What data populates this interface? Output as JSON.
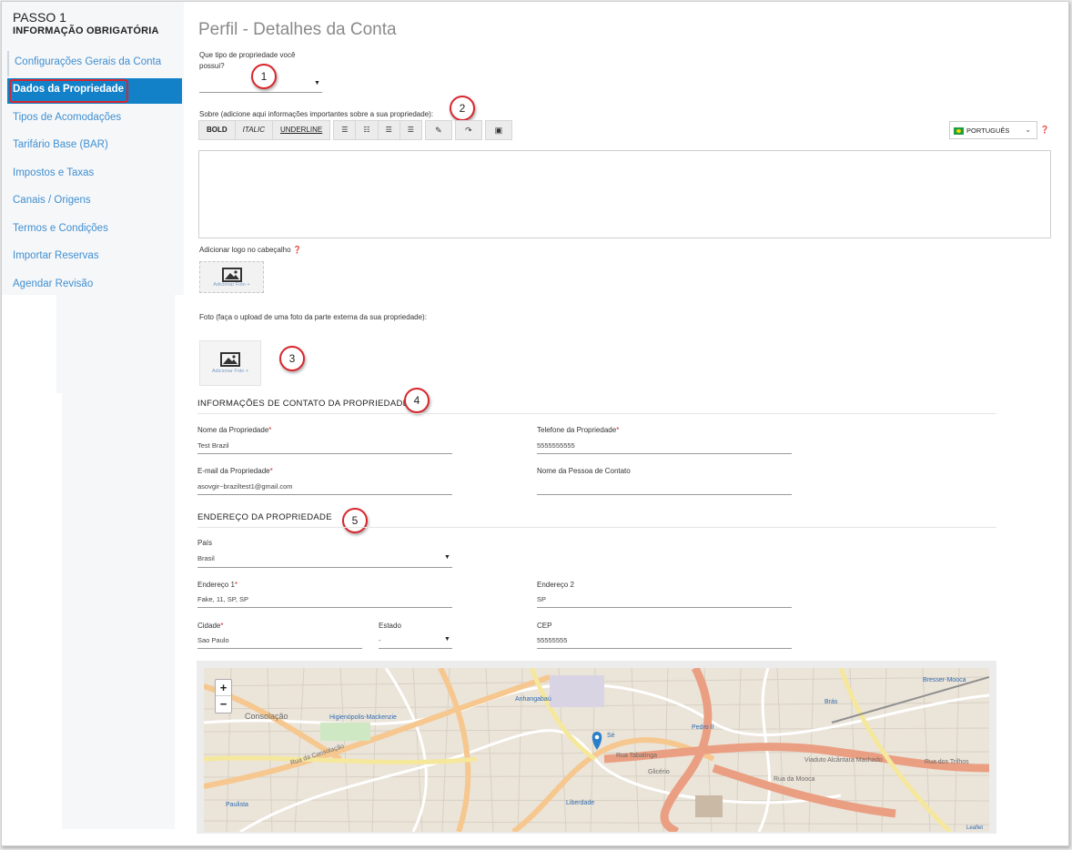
{
  "sidebar": {
    "step": "PASSO 1",
    "subtitle": "INFORMAÇÃO OBRIGATÓRIA",
    "items": [
      {
        "label": "Configurações Gerais da Conta"
      },
      {
        "label": "Dados da Propriedade"
      },
      {
        "label": "Tipos de Acomodações"
      },
      {
        "label": "Tarifário Base (BAR)"
      },
      {
        "label": "Impostos e Taxas"
      },
      {
        "label": "Canais / Origens"
      },
      {
        "label": "Termos e Condições"
      },
      {
        "label": "Importar Reservas"
      },
      {
        "label": "Agendar Revisão"
      }
    ]
  },
  "page": {
    "title": "Perfil - Detalhes da Conta"
  },
  "property_type": {
    "label_line1": "Que tipo de propriedade você",
    "label_line2": "possui?",
    "value": ""
  },
  "about": {
    "label": "Sobre (adicione aqui informações importantes sobre a sua propriedade):",
    "toolbar": {
      "bold": "BOLD",
      "italic": "ITALIC",
      "underline": "UNDERLINE"
    },
    "language": "PORTUGUÊS",
    "content": ""
  },
  "logo": {
    "label": "Adicionar logo no cabeçalho",
    "button": "Adicionar Foto +"
  },
  "photo": {
    "label": "Foto (faça o upload de uma foto da parte externa da sua propriedade):",
    "button": "Adicionar Foto +"
  },
  "contact": {
    "heading": "INFORMAÇÕES DE CONTATO DA PROPRIEDADE",
    "name_label": "Nome da Propriedade",
    "name_value": "Test Brazil",
    "phone_label": "Telefone da Propriedade",
    "phone_value": "5555555555",
    "email_label": "E-mail da Propriedade",
    "email_value": "asovgir~braziltest1@gmail.com",
    "contact_person_label": "Nome da Pessoa de Contato",
    "contact_person_value": ""
  },
  "address": {
    "heading": "ENDEREÇO DA PROPRIEDADE",
    "country_label": "País",
    "country_value": "Brasil",
    "address1_label": "Endereço 1",
    "address1_value": "Fake, 11, SP, SP",
    "address2_label": "Endereço 2",
    "address2_value": "SP",
    "city_label": "Cidade",
    "city_value": "Sao Paulo",
    "state_label": "Estado",
    "state_value": "-",
    "zip_label": "CEP",
    "zip_value": "55555555"
  },
  "map": {
    "zoom_in": "+",
    "zoom_out": "−",
    "labels": [
      "Consolação",
      "Higienópolis-Mackenzie",
      "Anhangabaú",
      "Sé",
      "Pedro II",
      "Brás",
      "Bresser-Mooca",
      "Glicério",
      "Liberdade",
      "Paulista",
      "Rua da Consolação",
      "Rua Tabatinga",
      "Viaduto Alcântara Machado",
      "Rua dos Trilhos",
      "Rua da Mooca",
      "Leaflet"
    ]
  },
  "callouts": [
    "1",
    "2",
    "3",
    "4",
    "5"
  ],
  "colors": {
    "accent": "#1381c8",
    "link": "#3f8fd1",
    "callout": "#d8262c"
  }
}
